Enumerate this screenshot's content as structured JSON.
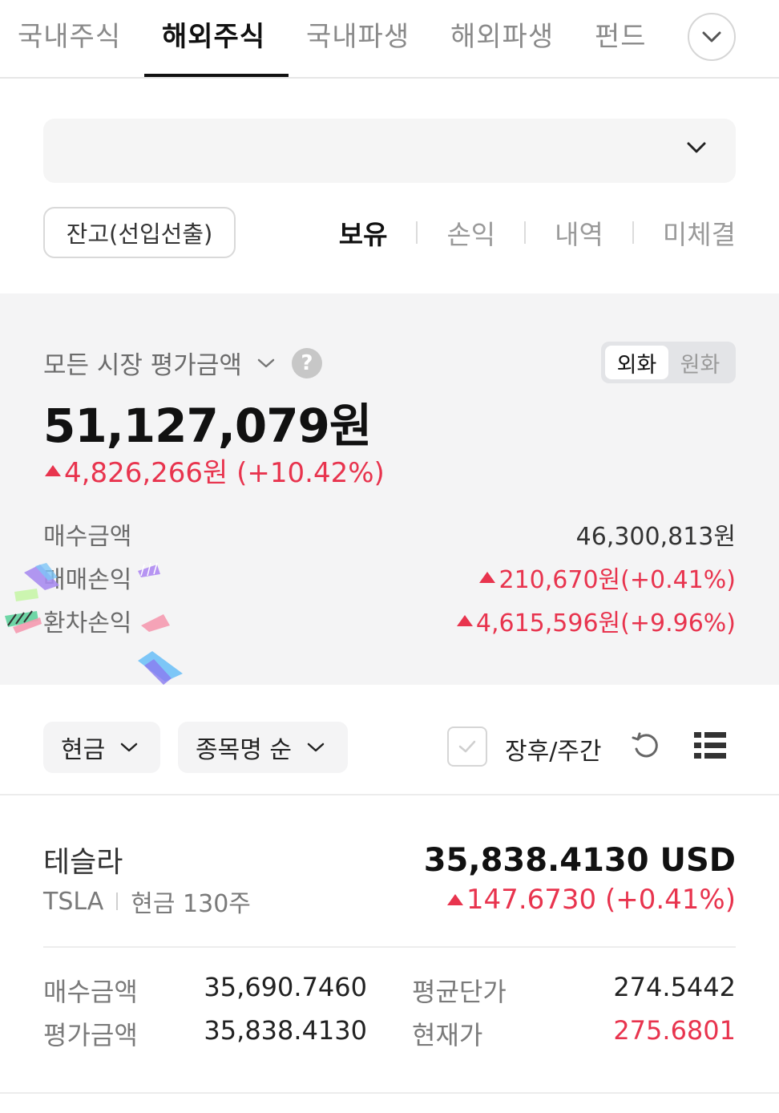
{
  "top_tabs": [
    {
      "label": "국내주식",
      "active": false
    },
    {
      "label": "해외주식",
      "active": true
    },
    {
      "label": "국내파생",
      "active": false
    },
    {
      "label": "해외파생",
      "active": false
    },
    {
      "label": "펀드",
      "active": false
    }
  ],
  "account": {
    "icon": "chevron-down-icon"
  },
  "balance_button": "잔고(선입선출)",
  "view_tabs": [
    "보유",
    "손익",
    "내역",
    "미체결"
  ],
  "summary": {
    "title": "모든 시장 평가금액",
    "help_icon": "?",
    "currency": {
      "foreign": "외화",
      "won": "원화",
      "selected": "외화"
    },
    "total": "51,127,079원",
    "change": "4,826,266원 (+10.42%)",
    "rows": [
      {
        "label": "매수금액",
        "value": "46,300,813원"
      },
      {
        "label": "매매손익",
        "value": "210,670원(+0.41%)"
      },
      {
        "label": "환차손익",
        "value": "4,615,596원(+9.96%)"
      }
    ]
  },
  "filters": {
    "cash": "현금",
    "sort": "종목명 순",
    "after_hours": "장후/주간"
  },
  "stock": {
    "name": "테슬라",
    "ticker": "TSLA",
    "holding": "현금 130주",
    "value": "35,838.4130 USD",
    "change": "147.6730 (+0.41%)",
    "purchase_label": "매수금액",
    "purchase_value": "35,690.7460",
    "eval_label": "평가금액",
    "eval_value": "35,838.4130",
    "avg_label": "평균단가",
    "avg_value": "274.5442",
    "current_label": "현재가",
    "current_value": "275.6801"
  },
  "colors": {
    "up": "#e8344e",
    "text": "#111111",
    "panel": "#f4f4f5"
  }
}
